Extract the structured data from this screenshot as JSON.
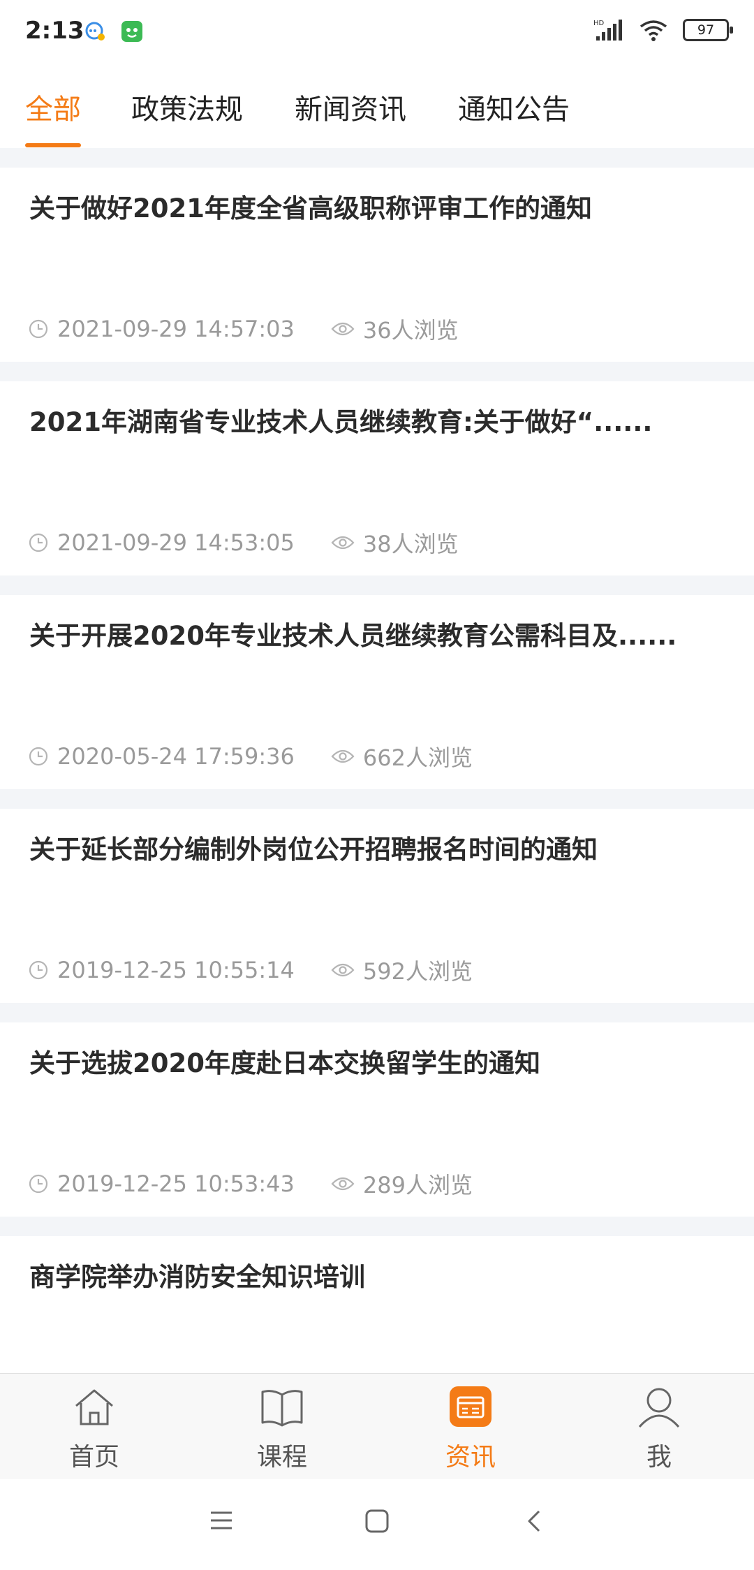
{
  "status_bar": {
    "time": "2:13",
    "battery": "97"
  },
  "tabs": [
    {
      "label": "全部",
      "active": true
    },
    {
      "label": "政策法规",
      "active": false
    },
    {
      "label": "新闻资讯",
      "active": false
    },
    {
      "label": "通知公告",
      "active": false
    }
  ],
  "articles": [
    {
      "title": "关于做好2021年度全省高级职称评审工作的通知",
      "time": "2021-09-29 14:57:03",
      "views": "36人浏览"
    },
    {
      "title": "2021年湖南省专业技术人员继续教育:关于做好“......",
      "time": "2021-09-29 14:53:05",
      "views": "38人浏览"
    },
    {
      "title": "关于开展2020年专业技术人员继续教育公需科目及......",
      "time": "2020-05-24 17:59:36",
      "views": "662人浏览"
    },
    {
      "title": "关于延长部分编制外岗位公开招聘报名时间的通知",
      "time": "2019-12-25 10:55:14",
      "views": "592人浏览"
    },
    {
      "title": "关于选拔2020年度赴日本交换留学生的通知",
      "time": "2019-12-25 10:53:43",
      "views": "289人浏览"
    },
    {
      "title": "商学院举办消防安全知识培训",
      "time": "",
      "views": ""
    }
  ],
  "bottom_nav": [
    {
      "label": "首页",
      "icon": "home-icon",
      "active": false
    },
    {
      "label": "课程",
      "icon": "book-icon",
      "active": false
    },
    {
      "label": "资讯",
      "icon": "news-icon",
      "active": true
    },
    {
      "label": "我",
      "icon": "user-icon",
      "active": false
    }
  ],
  "colors": {
    "accent": "#f47b16",
    "text": "#2b2b2b",
    "muted": "#9a9a9a",
    "separator": "#f3f5f8"
  }
}
